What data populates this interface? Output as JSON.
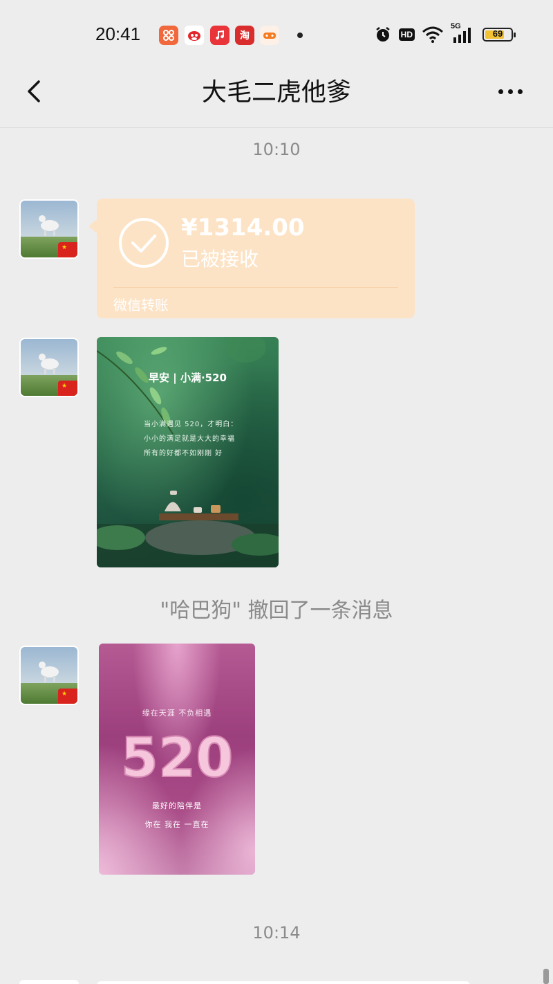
{
  "status_bar": {
    "time": "20:41",
    "notification_icons": [
      "app-icon",
      "app-icon",
      "music-icon",
      "taobao-icon",
      "game-icon"
    ],
    "taobao_char": "淘",
    "network": "5G",
    "hd_label": "HD",
    "battery_percent": 69,
    "battery_label": "69"
  },
  "nav": {
    "title": "大毛二虎他爹"
  },
  "messages": {
    "timestamp_1": "10:10",
    "transfer": {
      "amount": "¥1314.00",
      "status": "已被接收",
      "footer": "微信转账",
      "color": "#fde3c6"
    },
    "forest_image": {
      "title": "早安 | 小满·520",
      "line1": "当小满遇见 520，才明白：",
      "line2": "小小的满足就是大大的幸福",
      "line3": "所有的好都不如刚刚 好"
    },
    "recall_notice": "\"哈巴狗\" 撤回了一条消息",
    "sakura_image": {
      "tagline": "缘在天涯  不负相遇",
      "big_text": "520",
      "sub1": "最好的陪伴是",
      "sub2": "你在  我在  一直在"
    },
    "timestamp_2": "10:14"
  }
}
